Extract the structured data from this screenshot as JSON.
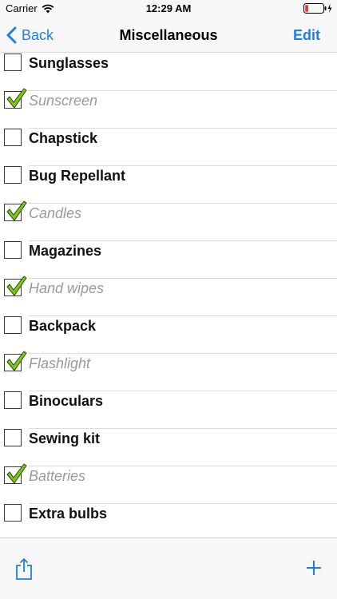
{
  "status_bar": {
    "carrier": "Carrier",
    "time": "12:29 AM",
    "icons": [
      "wifi-icon",
      "battery-icon",
      "charging-bolt-icon"
    ]
  },
  "nav": {
    "back_label": "Back",
    "title": "Miscellaneous",
    "edit_label": "Edit"
  },
  "colors": {
    "accent": "#1f7ee8",
    "check_green": "#7cc61a",
    "done_text": "#9a9a9a",
    "bar_background": "#f7f7f7",
    "battery_low": "#e53935"
  },
  "items": [
    {
      "label": "Sunglasses",
      "checked": false
    },
    {
      "label": "Sunscreen",
      "checked": true
    },
    {
      "label": "Chapstick",
      "checked": false
    },
    {
      "label": "Bug Repellant",
      "checked": false
    },
    {
      "label": "Candles",
      "checked": true
    },
    {
      "label": "Magazines",
      "checked": false
    },
    {
      "label": "Hand wipes",
      "checked": true
    },
    {
      "label": "Backpack",
      "checked": false
    },
    {
      "label": "Flashlight",
      "checked": true
    },
    {
      "label": "Binoculars",
      "checked": false
    },
    {
      "label": "Sewing kit",
      "checked": false
    },
    {
      "label": "Batteries",
      "checked": true
    },
    {
      "label": "Extra bulbs",
      "checked": false
    }
  ],
  "toolbar": {
    "left_icon": "share-icon",
    "right_icon": "add-icon"
  }
}
